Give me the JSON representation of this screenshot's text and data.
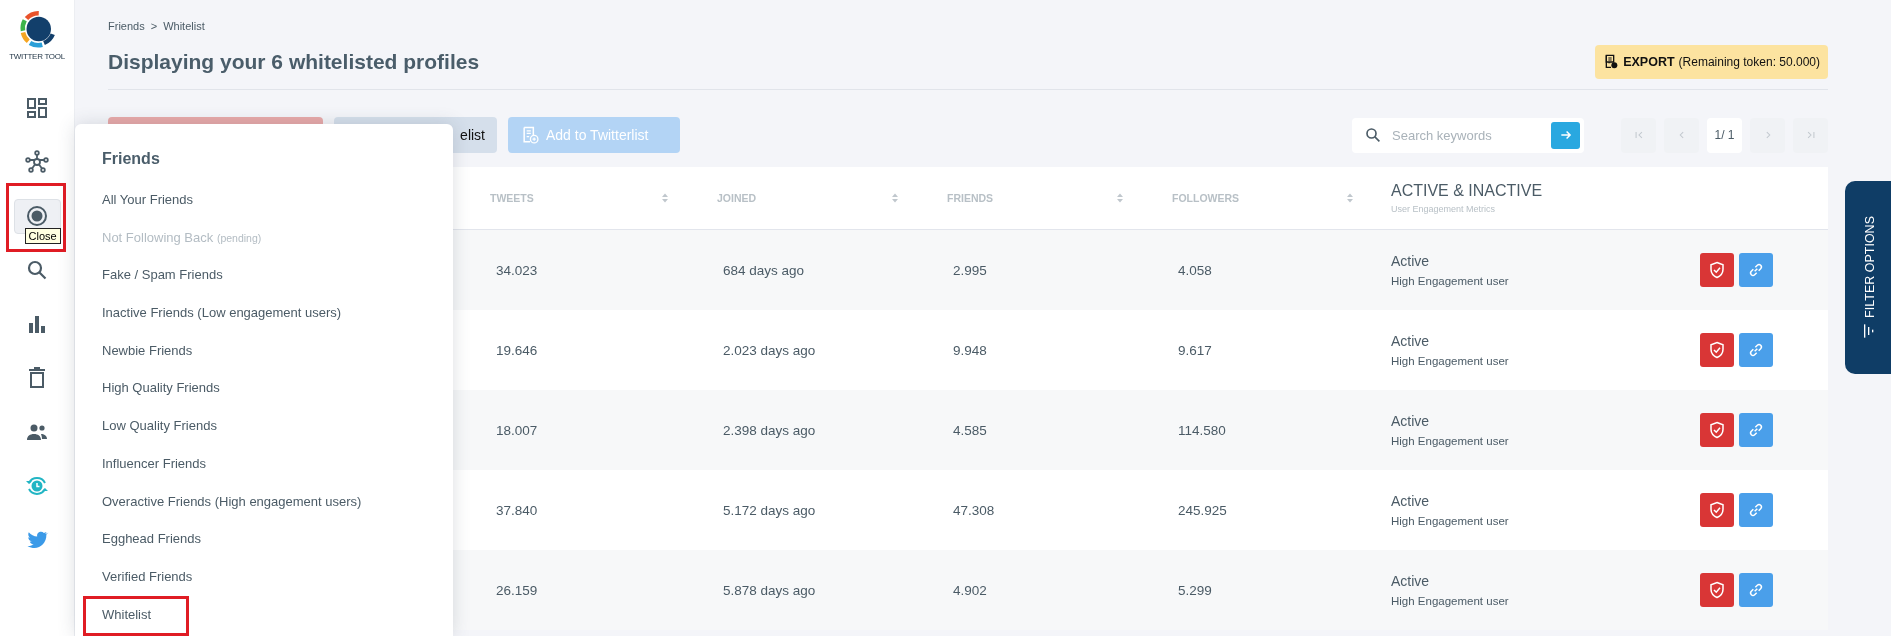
{
  "sidebar": {
    "logo_text": "TWITTER TOOL",
    "tooltip": "Close",
    "items": [
      {
        "kind": "dashboard",
        "selected": false,
        "highlighted": false
      },
      {
        "kind": "network",
        "selected": false,
        "highlighted": false
      },
      {
        "kind": "target",
        "selected": true,
        "highlighted": true
      },
      {
        "kind": "search",
        "selected": false,
        "highlighted": false
      },
      {
        "kind": "chart",
        "selected": false,
        "highlighted": false
      },
      {
        "kind": "trash",
        "selected": false,
        "highlighted": false
      },
      {
        "kind": "people",
        "selected": false,
        "highlighted": false
      },
      {
        "kind": "clock",
        "selected": false,
        "highlighted": false
      },
      {
        "kind": "bird",
        "selected": false,
        "highlighted": false
      }
    ]
  },
  "breadcrumb": {
    "items": [
      "Friends",
      "Whitelist"
    ],
    "separator": ">"
  },
  "title": "Displaying your 6 whitelisted profiles",
  "export": {
    "label": "EXPORT",
    "note": "(Remaining token: 50.000)"
  },
  "toolbar": {
    "buttons": [
      {
        "kind": "danger",
        "disabled": true
      },
      {
        "kind": "secondary",
        "label": "elist",
        "disabled": false
      },
      {
        "kind": "primary",
        "label": "Add to Twitterlist",
        "disabled": true
      }
    ]
  },
  "search": {
    "placeholder": "Search keywords"
  },
  "pagination": {
    "page": "1/ 1"
  },
  "table": {
    "columns": [
      {
        "label": "TWEETS",
        "sortable": true
      },
      {
        "label": "JOINED",
        "sortable": true
      },
      {
        "label": "FRIENDS",
        "sortable": true
      },
      {
        "label": "FOLLOWERS",
        "sortable": true
      },
      {
        "label": "ACTIVE & INACTIVE",
        "sublabel": "User Engagement Metrics",
        "sortable": false
      }
    ],
    "rows": [
      {
        "cells": [
          "34.023",
          "684 days ago",
          "2.995",
          "4.058"
        ],
        "status": "Active",
        "engagement": "High Engagement user"
      },
      {
        "cells": [
          "19.646",
          "2.023 days ago",
          "9.948",
          "9.617"
        ],
        "status": "Active",
        "engagement": "High Engagement user"
      },
      {
        "cells": [
          "18.007",
          "2.398 days ago",
          "4.585",
          "114.580"
        ],
        "status": "Active",
        "engagement": "High Engagement user"
      },
      {
        "cells": [
          "37.840",
          "5.172 days ago",
          "47.308",
          "245.925"
        ],
        "status": "Active",
        "engagement": "High Engagement user"
      },
      {
        "cells": [
          "26.159",
          "5.878 days ago",
          "4.902",
          "5.299"
        ],
        "status": "Active",
        "engagement": "High Engagement user"
      }
    ]
  },
  "menu": {
    "title": "Friends",
    "items": [
      {
        "label": "All Your Friends",
        "disabled": false,
        "highlighted": false
      },
      {
        "label": "Not Following Back",
        "note": "(pending)",
        "disabled": true,
        "highlighted": false
      },
      {
        "label": "Fake / Spam Friends",
        "disabled": false,
        "highlighted": false
      },
      {
        "label": "Inactive Friends (Low engagement users)",
        "disabled": false,
        "highlighted": false
      },
      {
        "label": "Newbie Friends",
        "disabled": false,
        "highlighted": false
      },
      {
        "label": "High Quality Friends",
        "disabled": false,
        "highlighted": false
      },
      {
        "label": "Low Quality Friends",
        "disabled": false,
        "highlighted": false
      },
      {
        "label": "Influencer Friends",
        "disabled": false,
        "highlighted": false
      },
      {
        "label": "Overactive Friends (High engagement users)",
        "disabled": false,
        "highlighted": false
      },
      {
        "label": "Egghead Friends",
        "disabled": false,
        "highlighted": false
      },
      {
        "label": "Verified Friends",
        "disabled": false,
        "highlighted": false
      },
      {
        "label": "Whitelist",
        "disabled": false,
        "highlighted": true
      }
    ]
  },
  "filter_tab": {
    "label": "FILTER OPTIONS"
  }
}
